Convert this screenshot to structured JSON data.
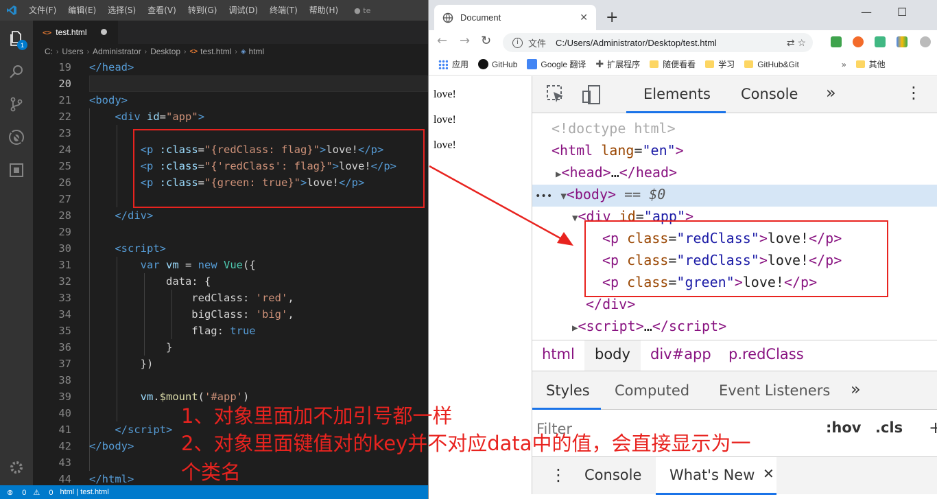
{
  "vscode": {
    "menu": [
      "文件(F)",
      "编辑(E)",
      "选择(S)",
      "查看(V)",
      "转到(G)",
      "调试(D)",
      "终端(T)",
      "帮助(H)"
    ],
    "window_title": "● te",
    "explorer_badge": "1",
    "tab_label": "test.html",
    "breadcrumb": [
      "C:",
      "Users",
      "Administrator",
      "Desktop",
      "test.html",
      "html"
    ],
    "line_numbers": [
      "19",
      "20",
      "21",
      "22",
      "23",
      "24",
      "25",
      "26",
      "27",
      "28",
      "29",
      "30",
      "31",
      "32",
      "33",
      "34",
      "35",
      "36",
      "37",
      "38",
      "39",
      "40",
      "41",
      "42",
      "43",
      "44"
    ],
    "status": {
      "errors": "0",
      "warnings": "0",
      "crumb": "html | test.html"
    },
    "annotations": [
      "1、对象里面加不加引号都一样",
      "2、对象里面键值对的key并不对应data中的值，会直接显示为一",
      "个类名"
    ]
  },
  "chrome": {
    "tab_title": "Document",
    "omnibox_label": "文件",
    "url": "C:/Users/Administrator/Desktop/test.html",
    "bookmarks": [
      "应用",
      "GitHub",
      "Google 翻译",
      "扩展程序",
      "随便看看",
      "学习",
      "GitHub&Git",
      "其他"
    ],
    "page_items": [
      "love!",
      "love!",
      "love!"
    ],
    "devtools": {
      "tabs": [
        "Elements",
        "Console"
      ],
      "crumbs": [
        "html",
        "body",
        "div#app",
        "p.redClass"
      ],
      "style_tabs": [
        "Styles",
        "Computed",
        "Event Listeners"
      ],
      "filter_placeholder": "Filter",
      "hov": ":hov",
      "cls": ".cls",
      "drawer_tabs": [
        "Console",
        "What's New"
      ],
      "dom_selected_suffix": " == $0"
    }
  },
  "colors": {
    "annotation_red": "#e8231f",
    "vscode_blue": "#007acc",
    "devtools_accent": "#1a73e8"
  }
}
